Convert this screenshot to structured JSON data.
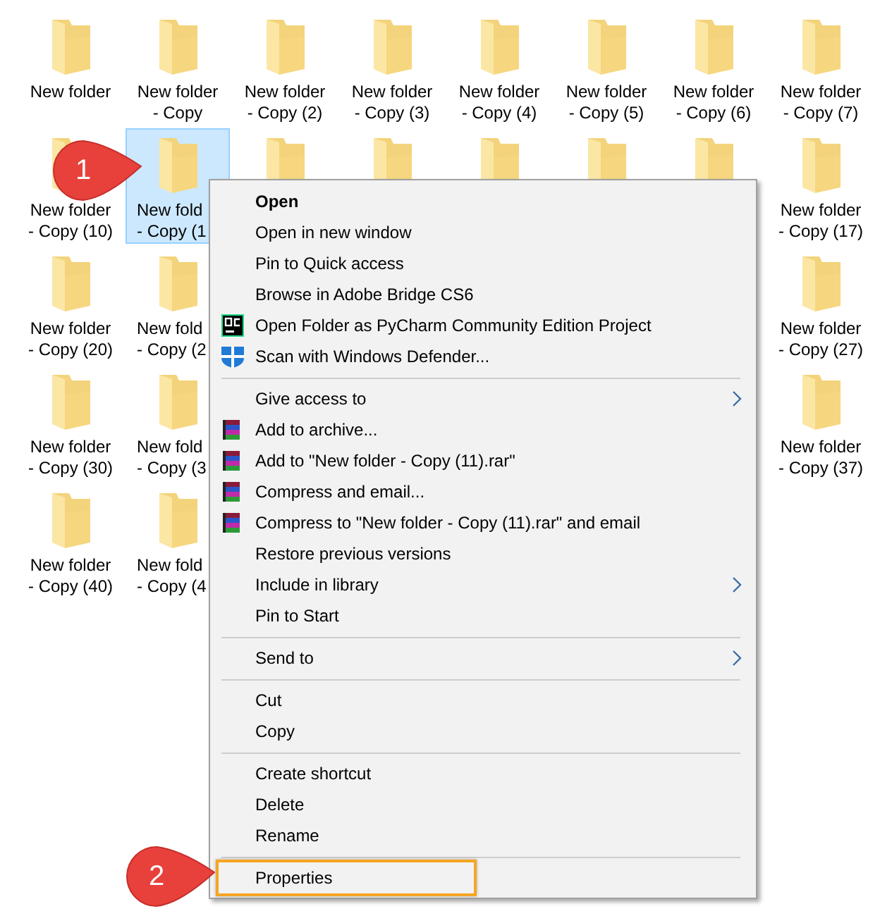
{
  "folders": {
    "rows": [
      {
        "cells": [
          {
            "kind": "folder",
            "lines": [
              "New folder"
            ],
            "selected": false
          },
          {
            "kind": "folder",
            "lines": [
              "New folder",
              "- Copy"
            ],
            "selected": false
          },
          {
            "kind": "folder",
            "lines": [
              "New folder",
              "- Copy (2)"
            ],
            "selected": false
          },
          {
            "kind": "folder",
            "lines": [
              "New folder",
              "- Copy (3)"
            ],
            "selected": false
          },
          {
            "kind": "folder",
            "lines": [
              "New folder",
              "- Copy (4)"
            ],
            "selected": false
          },
          {
            "kind": "folder",
            "lines": [
              "New folder",
              "- Copy (5)"
            ],
            "selected": false
          },
          {
            "kind": "folder",
            "lines": [
              "New folder",
              "- Copy (6)"
            ],
            "selected": false
          },
          {
            "kind": "folder",
            "lines": [
              "New folder",
              "- Copy (7)"
            ],
            "selected": false
          }
        ]
      },
      {
        "cells": [
          {
            "kind": "folder",
            "lines": [
              "New folder",
              "- Copy (10)"
            ],
            "selected": false
          },
          {
            "kind": "cut",
            "lines": [
              "New fold",
              "- Copy (1"
            ],
            "selected": true
          },
          {
            "kind": "icon"
          },
          {
            "kind": "icon"
          },
          {
            "kind": "icon"
          },
          {
            "kind": "icon"
          },
          {
            "kind": "icon"
          },
          {
            "kind": "folder",
            "lines": [
              "New folder",
              "- Copy (17)"
            ],
            "selected": false
          }
        ]
      },
      {
        "cells": [
          {
            "kind": "folder",
            "lines": [
              "New folder",
              "- Copy (20)"
            ],
            "selected": false
          },
          {
            "kind": "cut",
            "lines": [
              "New fold",
              "- Copy (2"
            ],
            "selected": false
          },
          {
            "kind": "covered"
          },
          {
            "kind": "covered"
          },
          {
            "kind": "covered"
          },
          {
            "kind": "covered"
          },
          {
            "kind": "covered"
          },
          {
            "kind": "folder",
            "lines": [
              "New folder",
              "- Copy (27)"
            ],
            "selected": false
          }
        ]
      },
      {
        "cells": [
          {
            "kind": "folder",
            "lines": [
              "New folder",
              "- Copy (30)"
            ],
            "selected": false
          },
          {
            "kind": "cut",
            "lines": [
              "New fold",
              "- Copy (3"
            ],
            "selected": false
          },
          {
            "kind": "covered"
          },
          {
            "kind": "covered"
          },
          {
            "kind": "covered"
          },
          {
            "kind": "covered"
          },
          {
            "kind": "covered"
          },
          {
            "kind": "folder",
            "lines": [
              "New folder",
              "- Copy (37)"
            ],
            "selected": false
          }
        ]
      },
      {
        "cells": [
          {
            "kind": "folder",
            "lines": [
              "New folder",
              "- Copy (40)"
            ],
            "selected": false
          },
          {
            "kind": "cut",
            "lines": [
              "New fold",
              "- Copy (4"
            ],
            "selected": false
          }
        ]
      }
    ]
  },
  "context_menu": {
    "items": [
      {
        "kind": "item",
        "label": "Open",
        "bold": true
      },
      {
        "kind": "item",
        "label": "Open in new window"
      },
      {
        "kind": "item",
        "label": "Pin to Quick access"
      },
      {
        "kind": "item",
        "label": "Browse in Adobe Bridge CS6"
      },
      {
        "kind": "pycharm",
        "label": "Open Folder as PyCharm Community Edition Project"
      },
      {
        "kind": "shield",
        "label": "Scan with Windows Defender..."
      },
      {
        "kind": "separator"
      },
      {
        "kind": "item",
        "label": "Give access to",
        "submenu": true
      },
      {
        "kind": "archive",
        "label": "Add to archive..."
      },
      {
        "kind": "archive",
        "label": "Add to \"New folder - Copy (11).rar\""
      },
      {
        "kind": "archive",
        "label": "Compress and email..."
      },
      {
        "kind": "archive",
        "label": "Compress to \"New folder - Copy (11).rar\" and email"
      },
      {
        "kind": "item",
        "label": "Restore previous versions"
      },
      {
        "kind": "item",
        "label": "Include in library",
        "submenu": true
      },
      {
        "kind": "item",
        "label": "Pin to Start"
      },
      {
        "kind": "separator"
      },
      {
        "kind": "item",
        "label": "Send to",
        "submenu": true
      },
      {
        "kind": "separator"
      },
      {
        "kind": "item",
        "label": "Cut"
      },
      {
        "kind": "item",
        "label": "Copy"
      },
      {
        "kind": "separator"
      },
      {
        "kind": "item",
        "label": "Create shortcut"
      },
      {
        "kind": "item",
        "label": "Delete"
      },
      {
        "kind": "item",
        "label": "Rename"
      },
      {
        "kind": "separator"
      },
      {
        "kind": "item",
        "label": "Properties",
        "highlighted": true
      }
    ]
  },
  "callouts": [
    {
      "label": "1"
    },
    {
      "label": "2"
    }
  ]
}
